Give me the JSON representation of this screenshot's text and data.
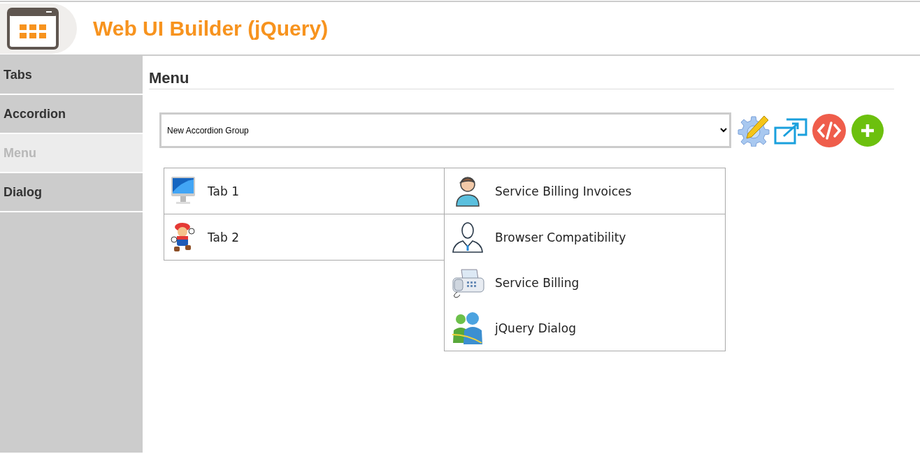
{
  "header": {
    "title": "Web UI Builder (jQuery)"
  },
  "sidebar": {
    "items": [
      {
        "label": "Tabs",
        "selected": false
      },
      {
        "label": "Accordion",
        "selected": false
      },
      {
        "label": "Menu",
        "selected": true
      },
      {
        "label": "Dialog",
        "selected": false
      }
    ]
  },
  "section": {
    "title": "Menu"
  },
  "group_select": {
    "value": "New Accordion Group"
  },
  "toolbar": [
    {
      "kind": "edit"
    },
    {
      "kind": "popout"
    },
    {
      "kind": "code"
    },
    {
      "kind": "add"
    }
  ],
  "menu": {
    "items": [
      {
        "label": "Tab 1",
        "kind": "monitor"
      },
      {
        "label": "Tab 2",
        "kind": "cartoon"
      }
    ]
  },
  "submenu": {
    "header": {
      "label": "Service Billing Invoices",
      "kind": "person"
    },
    "items": [
      {
        "label": "Browser Compatibility",
        "kind": "user"
      },
      {
        "label": "Service Billing",
        "kind": "fax"
      },
      {
        "label": "jQuery Dialog",
        "kind": "people"
      }
    ]
  }
}
